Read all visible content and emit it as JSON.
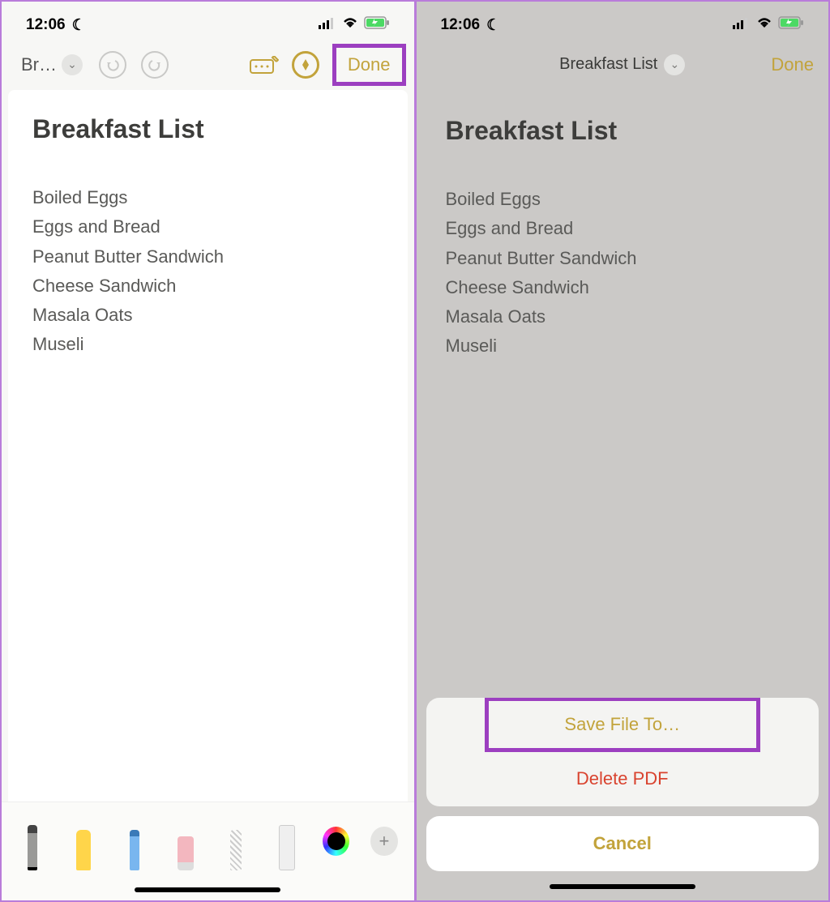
{
  "status": {
    "time": "12:06",
    "moon_icon": "☾",
    "signal_icon": "signal",
    "wifi_icon": "wifi",
    "battery_icon": "battery-charging"
  },
  "left": {
    "back_label": "Br…",
    "done_label": "Done",
    "note_title": "Breakfast List",
    "items": [
      "Boiled Eggs",
      "Eggs and Bread",
      "Peanut Butter Sandwich",
      "Cheese Sandwich",
      "Masala Oats",
      "Museli"
    ]
  },
  "right": {
    "header_title": "Breakfast List",
    "done_label": "Done",
    "note_title": "Breakfast List",
    "items": [
      "Boiled Eggs",
      "Eggs and Bread",
      "Peanut Butter Sandwich",
      "Cheese Sandwich",
      "Masala Oats",
      "Museli"
    ],
    "sheet": {
      "save_label": "Save File To…",
      "delete_label": "Delete PDF",
      "cancel_label": "Cancel"
    }
  }
}
